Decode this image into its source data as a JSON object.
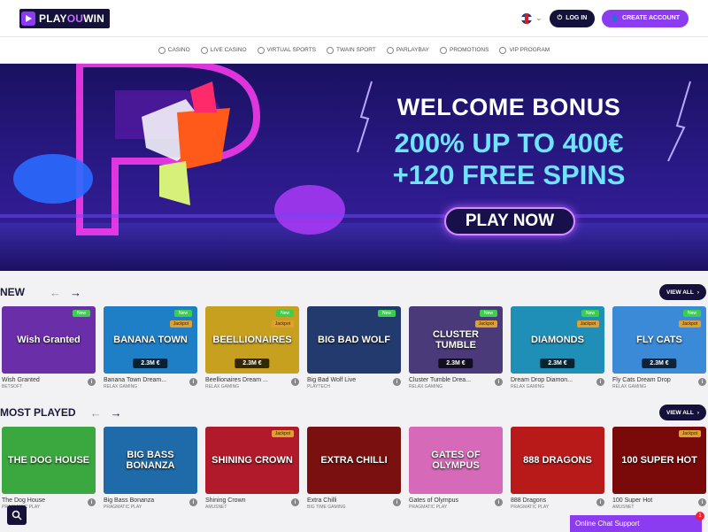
{
  "header": {
    "logo_part1": "PLAY",
    "logo_part2": "OU",
    "logo_part3": "WIN",
    "login_label": "LOG IN",
    "create_label": "CREATE ACCOUNT"
  },
  "nav": {
    "items": [
      {
        "label": "CASINO",
        "icon": "casino-icon"
      },
      {
        "label": "LIVE CASINO",
        "icon": "live-casino-icon"
      },
      {
        "label": "VIRTUAL SPORTS",
        "icon": "virtual-sports-icon"
      },
      {
        "label": "TWAIN SPORT",
        "icon": "twain-sport-icon"
      },
      {
        "label": "PARLAYBAY",
        "icon": "parlaybay-icon"
      },
      {
        "label": "PROMOTIONS",
        "icon": "promotions-icon"
      },
      {
        "label": "VIP PROGRAM",
        "icon": "vip-icon"
      }
    ]
  },
  "hero": {
    "title": "WELCOME BONUS",
    "line1": "200% UP TO 400€",
    "line2": "+120 FREE SPINS",
    "cta": "PLAY NOW"
  },
  "new_section": {
    "title": "NEW",
    "view_all": "VIEW ALL",
    "games": [
      {
        "title": "Wish Granted",
        "provider": "BETSOFT",
        "thumb_text": "Wish Granted",
        "bg": "#6a2fa8",
        "new": true,
        "jackpot_tag": false,
        "jackpot": ""
      },
      {
        "title": "Banana Town Dream...",
        "provider": "RELAX GAMING",
        "thumb_text": "BANANA TOWN",
        "bg": "#1f7fc6",
        "new": true,
        "jackpot_tag": true,
        "jackpot": "2.3M €"
      },
      {
        "title": "Beellionaires Dream ...",
        "provider": "RELAX GAMING",
        "thumb_text": "BEELLIONAIRES",
        "bg": "#c7a020",
        "new": true,
        "jackpot_tag": true,
        "jackpot": "2.3M €"
      },
      {
        "title": "Big Bad Wolf Live",
        "provider": "PLAYTECH",
        "thumb_text": "BIG BAD WOLF",
        "bg": "#233a6e",
        "new": true,
        "jackpot_tag": false,
        "jackpot": ""
      },
      {
        "title": "Cluster Tumble Drea...",
        "provider": "RELAX GAMING",
        "thumb_text": "CLUSTER TUMBLE",
        "bg": "#4a3a7a",
        "new": true,
        "jackpot_tag": true,
        "jackpot": "2.3M €"
      },
      {
        "title": "Dream Drop Diamon...",
        "provider": "RELAX GAMING",
        "thumb_text": "DIAMONDS",
        "bg": "#1f8fb8",
        "new": true,
        "jackpot_tag": true,
        "jackpot": "2.3M €"
      },
      {
        "title": "Fly Cats Dream Drop",
        "provider": "RELAX GAMING",
        "thumb_text": "FLY CATS",
        "bg": "#3a8ad8",
        "new": true,
        "jackpot_tag": true,
        "jackpot": "2.3M €"
      }
    ]
  },
  "most_played": {
    "title": "MOST PLAYED",
    "view_all": "VIEW ALL",
    "games": [
      {
        "title": "The Dog House",
        "provider": "PRAGMATIC PLAY",
        "thumb_text": "THE DOG HOUSE",
        "bg": "#3aa83e",
        "jackpot_tag": false
      },
      {
        "title": "Big Bass Bonanza",
        "provider": "PRAGMATIC PLAY",
        "thumb_text": "BIG BASS BONANZA",
        "bg": "#1f6aa8",
        "jackpot_tag": false
      },
      {
        "title": "Shining Crown",
        "provider": "AMUSNET",
        "thumb_text": "SHINING CROWN",
        "bg": "#b01a2a",
        "jackpot_tag": true
      },
      {
        "title": "Extra Chilli",
        "provider": "BIG TIME GAMING",
        "thumb_text": "EXTRA CHILLI",
        "bg": "#7a1010",
        "jackpot_tag": false
      },
      {
        "title": "Gates of Olympus",
        "provider": "PRAGMATIC PLAY",
        "thumb_text": "GATES OF OLYMPUS",
        "bg": "#d66ab8",
        "jackpot_tag": false
      },
      {
        "title": "888 Dragons",
        "provider": "PRAGMATIC PLAY",
        "thumb_text": "888 DRAGONS",
        "bg": "#b81a1a",
        "jackpot_tag": false
      },
      {
        "title": "100 Super Hot",
        "provider": "AMUSNET",
        "thumb_text": "100 SUPER HOT",
        "bg": "#7a0a0a",
        "jackpot_tag": true
      }
    ]
  },
  "chat": {
    "label": "Online Chat Support",
    "badge": "1"
  },
  "colors": {
    "brand_dark": "#14123a",
    "brand_purple": "#8c3cf0",
    "hero_cyan": "#6ee4ff"
  }
}
